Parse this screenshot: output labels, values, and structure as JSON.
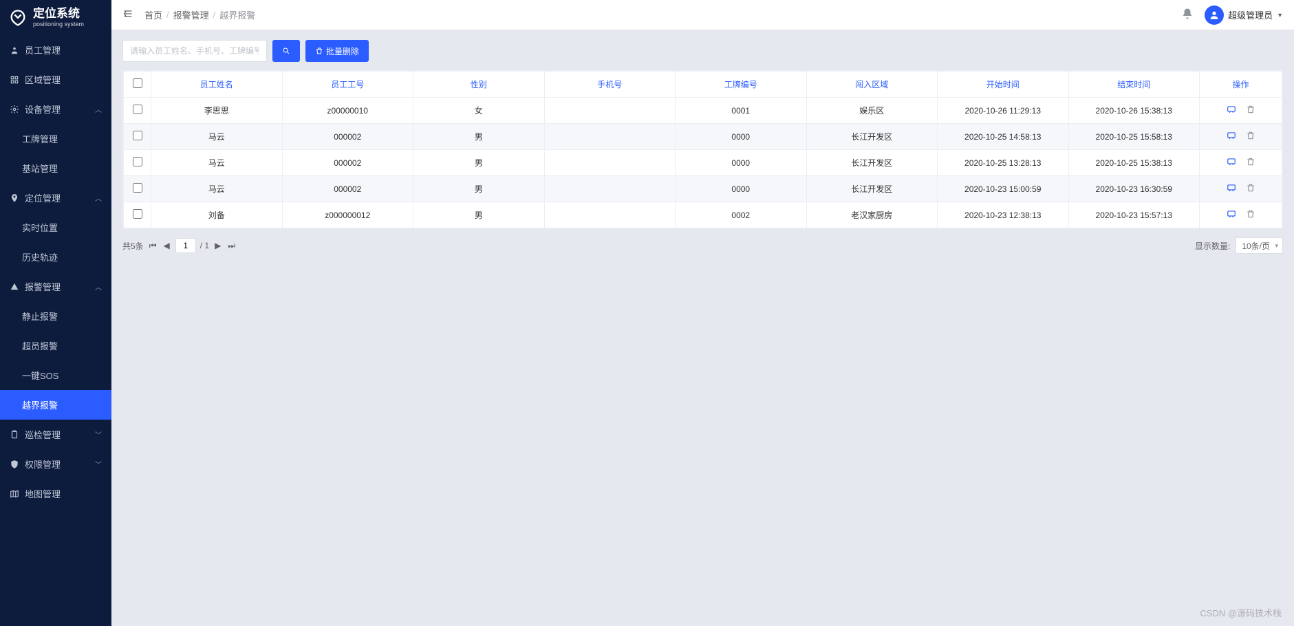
{
  "brand": {
    "title": "定位系统",
    "subtitle": "positioning system"
  },
  "sidebar": {
    "items": [
      {
        "label": "员工管理",
        "icon": "user",
        "type": "item"
      },
      {
        "label": "区域管理",
        "icon": "grid",
        "type": "item"
      },
      {
        "label": "设备管理",
        "icon": "gear",
        "type": "group",
        "expanded": true
      },
      {
        "label": "工牌管理",
        "type": "sub"
      },
      {
        "label": "基站管理",
        "type": "sub"
      },
      {
        "label": "定位管理",
        "icon": "pin",
        "type": "group",
        "expanded": true
      },
      {
        "label": "实时位置",
        "type": "sub"
      },
      {
        "label": "历史轨迹",
        "type": "sub"
      },
      {
        "label": "报警管理",
        "icon": "alert",
        "type": "group",
        "expanded": true
      },
      {
        "label": "静止报警",
        "type": "sub"
      },
      {
        "label": "超员报警",
        "type": "sub"
      },
      {
        "label": "一键SOS",
        "type": "sub"
      },
      {
        "label": "越界报警",
        "type": "sub",
        "active": true
      },
      {
        "label": "巡检管理",
        "icon": "clipboard",
        "type": "group",
        "expanded": false
      },
      {
        "label": "权限管理",
        "icon": "shield",
        "type": "group",
        "expanded": false
      },
      {
        "label": "地图管理",
        "icon": "map",
        "type": "item"
      }
    ]
  },
  "breadcrumb": [
    "首页",
    "报警管理",
    "越界报警"
  ],
  "user": {
    "name": "超级管理员"
  },
  "toolbar": {
    "search_placeholder": "请输入员工姓名、手机号、工牌编号...",
    "batch_delete": "批量删除"
  },
  "table": {
    "headers": [
      "员工姓名",
      "员工工号",
      "性别",
      "手机号",
      "工牌编号",
      "闯入区域",
      "开始时间",
      "结束时间",
      "操作"
    ],
    "rows": [
      {
        "name": "李思思",
        "empno": "z00000010",
        "gender": "女",
        "phone": "",
        "badge": "0001",
        "area": "娱乐区",
        "start": "2020-10-26 11:29:13",
        "end": "2020-10-26 15:38:13"
      },
      {
        "name": "马云",
        "empno": "000002",
        "gender": "男",
        "phone": "",
        "badge": "0000",
        "area": "长江开发区",
        "start": "2020-10-25 14:58:13",
        "end": "2020-10-25 15:58:13"
      },
      {
        "name": "马云",
        "empno": "000002",
        "gender": "男",
        "phone": "",
        "badge": "0000",
        "area": "长江开发区",
        "start": "2020-10-25 13:28:13",
        "end": "2020-10-25 15:38:13"
      },
      {
        "name": "马云",
        "empno": "000002",
        "gender": "男",
        "phone": "",
        "badge": "0000",
        "area": "长江开发区",
        "start": "2020-10-23 15:00:59",
        "end": "2020-10-23 16:30:59"
      },
      {
        "name": "刘备",
        "empno": "z000000012",
        "gender": "男",
        "phone": "",
        "badge": "0002",
        "area": "老汉家厨房",
        "start": "2020-10-23 12:38:13",
        "end": "2020-10-23 15:57:13"
      }
    ]
  },
  "pagination": {
    "total_label": "共5条",
    "page": "1",
    "total_pages": "/ 1",
    "page_size_label": "显示数量:",
    "page_size": "10条/页"
  },
  "watermark": "CSDN @源码技术栈"
}
